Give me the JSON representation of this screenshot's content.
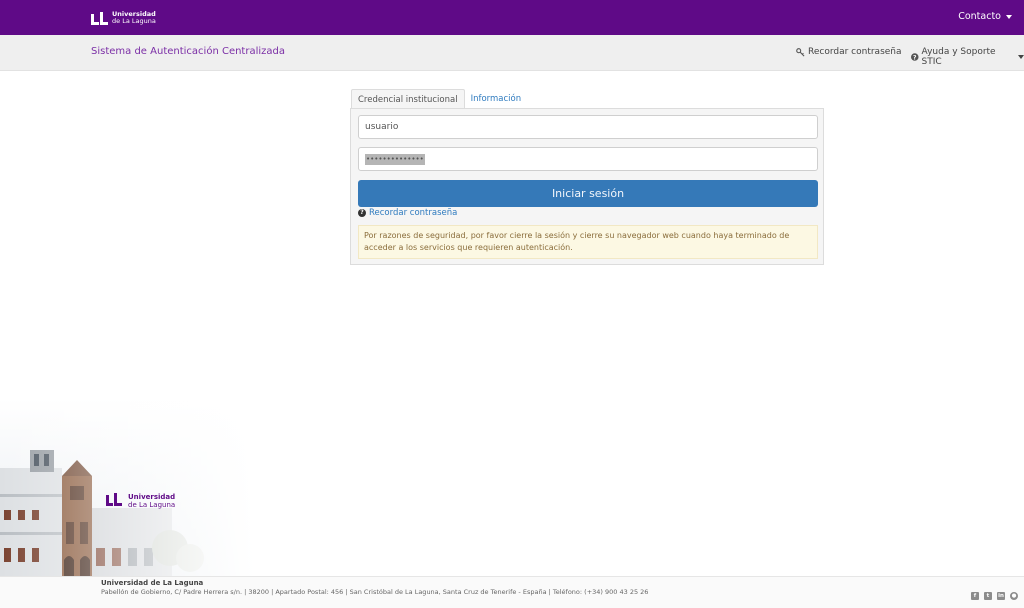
{
  "header": {
    "logo_line1": "Universidad",
    "logo_line2": "de La Laguna",
    "contact_label": "Contacto"
  },
  "subheader": {
    "system_title": "Sistema de Autenticación Centralizada",
    "recover_password": "Recordar contraseña",
    "help_support": "Ayuda y Soporte STIC"
  },
  "login": {
    "tabs": [
      {
        "label": "Credencial institucional",
        "active": true
      },
      {
        "label": "Información",
        "active": false
      }
    ],
    "username_value": "usuario",
    "password_value": "••••••••••••••",
    "submit_label": "Iniciar sesión",
    "forgot_link": "Recordar contraseña",
    "security_notice": "Por razones de seguridad, por favor cierre la sesión y cierre su navegador web cuando haya terminado de acceder a los servicios que requieren autenticación."
  },
  "watermark_logo": {
    "line1": "Universidad",
    "line2": "de La Laguna"
  },
  "footer": {
    "institution": "Universidad de La Laguna",
    "address": "Pabellón de Gobierno, C/ Padre Herrera s/n. | 38200 | Apartado Postal: 456 | San Cristóbal de La Laguna, Santa Cruz de Tenerife - España | Teléfono: (+34) 900 43 25 26",
    "social_icons": [
      "facebook-icon",
      "twitter-icon",
      "linkedin-icon",
      "globe-icon"
    ]
  },
  "colors": {
    "brand_purple": "#5f0a87",
    "title_purple": "#7b2fa6",
    "button_blue": "#3579b8",
    "link_blue": "#2f7bbf",
    "warning_bg": "#fcf8e3",
    "warning_text": "#8a6d3b"
  }
}
